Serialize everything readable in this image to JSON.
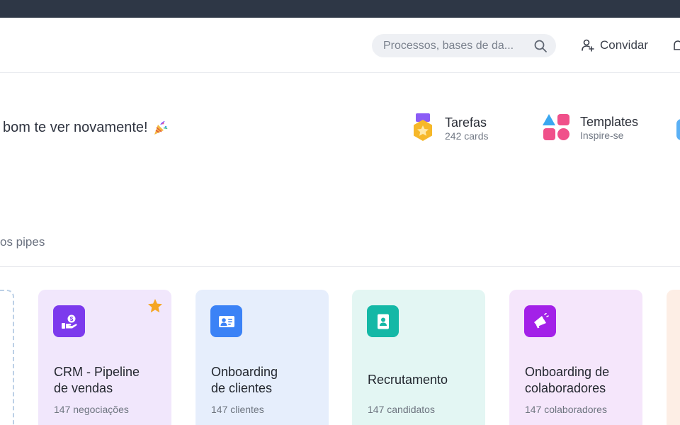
{
  "header": {
    "search_placeholder": "Processos, bases de da...",
    "invite_label": "Convidar"
  },
  "greeting": {
    "text": "bom te ver novamente!"
  },
  "shortcuts": [
    {
      "title": "Tarefas",
      "subtitle": "242 cards"
    },
    {
      "title": "Templates",
      "subtitle": "Inspire-se"
    }
  ],
  "section": {
    "label": "os pipes"
  },
  "pipes": [
    {
      "title": "CRM - Pipeline de vendas",
      "title_lines": [
        "CRM - Pipeline",
        "de vendas"
      ],
      "count": "147 negociações",
      "color": "#7c3aed",
      "bg": "#f1e7fc",
      "icon": "money-hand-icon",
      "favorite": true
    },
    {
      "title": "Onboarding de clientes",
      "title_lines": [
        "Onboarding",
        "de clientes"
      ],
      "count": "147 clientes",
      "color": "#3b82f6",
      "bg": "#e6eefc",
      "icon": "contact-card-icon",
      "favorite": false
    },
    {
      "title": "Recrutamento",
      "title_lines": [
        "Recrutamento"
      ],
      "count": "147 candidatos",
      "color": "#14b8a6",
      "bg": "#e3f6f3",
      "icon": "badge-icon",
      "favorite": false
    },
    {
      "title": "Onboarding de colaboradores",
      "title_lines": [
        "Onboarding de",
        "colaboradores"
      ],
      "count": "147 colaboradores",
      "color": "#a321e8",
      "bg": "#f5e6fb",
      "icon": "megaphone-icon",
      "favorite": false
    }
  ],
  "colors": {
    "topbar": "#2e3746",
    "star": "#f5a623"
  }
}
